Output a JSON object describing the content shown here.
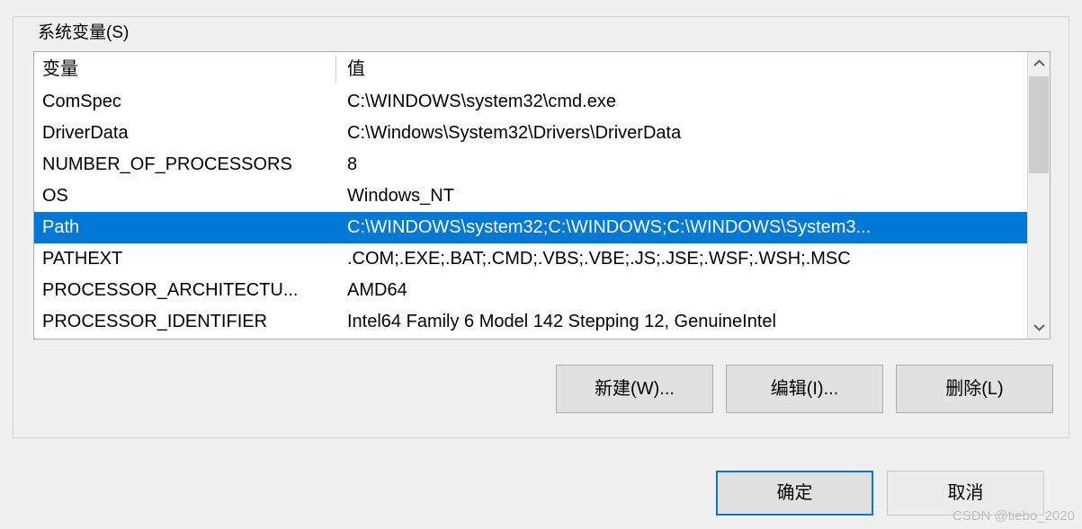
{
  "groupbox": {
    "title": "系统变量(S)"
  },
  "list": {
    "columns": {
      "name": "变量",
      "value": "值"
    },
    "rows": [
      {
        "name": "ComSpec",
        "value": "C:\\WINDOWS\\system32\\cmd.exe"
      },
      {
        "name": "DriverData",
        "value": "C:\\Windows\\System32\\Drivers\\DriverData"
      },
      {
        "name": "NUMBER_OF_PROCESSORS",
        "value": "8"
      },
      {
        "name": "OS",
        "value": "Windows_NT"
      },
      {
        "name": "Path",
        "value": "C:\\WINDOWS\\system32;C:\\WINDOWS;C:\\WINDOWS\\System3..."
      },
      {
        "name": "PATHEXT",
        "value": ".COM;.EXE;.BAT;.CMD;.VBS;.VBE;.JS;.JSE;.WSF;.WSH;.MSC"
      },
      {
        "name": "PROCESSOR_ARCHITECTU...",
        "value": "AMD64"
      },
      {
        "name": "PROCESSOR_IDENTIFIER",
        "value": "Intel64 Family 6 Model 142 Stepping 12, GenuineIntel"
      }
    ],
    "selected_index": 4,
    "scrollbar": {
      "up_icon": "chevron-up-icon",
      "down_icon": "chevron-down-icon"
    }
  },
  "actions": {
    "new": "新建(W)...",
    "edit": "编辑(I)...",
    "delete": "删除(L)"
  },
  "footer": {
    "ok": "确定",
    "cancel": "取消"
  },
  "watermark": "CSDN @tiebo_2020",
  "colors": {
    "accent": "#0078D7",
    "dialog_bg": "#F0F0F0",
    "button_face": "#E1E1E1",
    "list_bg": "#FFFFFF",
    "scrollbar_thumb": "#CDCDCD"
  }
}
